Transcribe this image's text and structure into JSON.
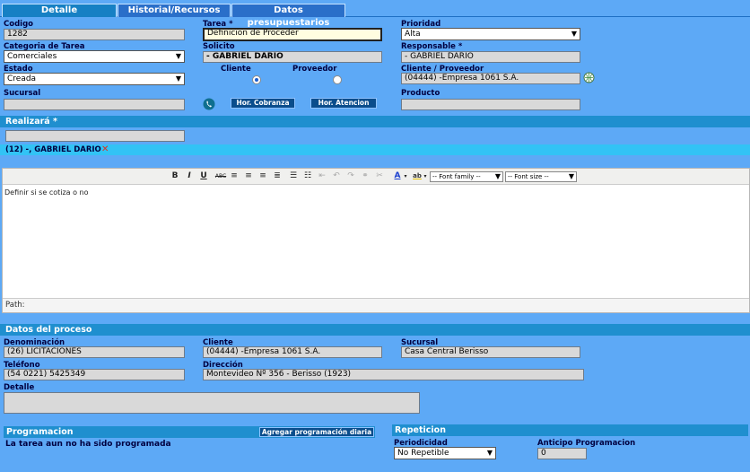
{
  "tabs": [
    {
      "label": "Detalle"
    },
    {
      "label": "Historial/Recursos"
    },
    {
      "label": "Datos presupuestarios"
    }
  ],
  "form": {
    "codigo": {
      "label": "Codigo",
      "value": "1282"
    },
    "tarea": {
      "label": "Tarea *",
      "value": "Definicion de Proceder"
    },
    "prioridad": {
      "label": "Prioridad",
      "value": "Alta"
    },
    "categoria": {
      "label": "Categoria de Tarea",
      "value": "Comerciales"
    },
    "solicito": {
      "label": "Solicito",
      "value": "- GABRIEL DARIO"
    },
    "responsable": {
      "label": "Responsable *",
      "value": "- GABRIEL DARIO"
    },
    "estado": {
      "label": "Estado",
      "value": "Creada"
    },
    "cliente_radio": {
      "label": "Cliente",
      "selected": true
    },
    "proveedor_radio": {
      "label": "Proveedor",
      "selected": false
    },
    "cliente_proveedor": {
      "label": "Cliente / Proveedor",
      "value": "(04444) -Empresa 1061 S.A."
    },
    "sucursal": {
      "label": "Sucursal",
      "value": ""
    },
    "producto": {
      "label": "Producto",
      "value": ""
    },
    "hor_cobranza_label": "Hor. Cobranza",
    "hor_atencion_label": "Hor. Atencion"
  },
  "realizara": {
    "title": "Realizará *",
    "input_value": "",
    "assignee": "(12) -, GABRIEL DARIO"
  },
  "editor": {
    "toolbar": {
      "bold": "B",
      "italic": "I",
      "underline": "U",
      "strike": "ABC",
      "font_family": "-- Font family --",
      "font_size": "-- Font size --"
    },
    "content": "Definir si se cotiza o no",
    "path_label": "Path:"
  },
  "datos_proceso": {
    "title": "Datos del proceso",
    "denominacion": {
      "label": "Denominación",
      "value": "(26) LICITACIONES"
    },
    "cliente": {
      "label": "Cliente",
      "value": "(04444) -Empresa 1061 S.A."
    },
    "sucursal": {
      "label": "Sucursal",
      "value": "Casa Central Berisso"
    },
    "telefono": {
      "label": "Teléfono",
      "value": "(54 0221) 5425349"
    },
    "direccion": {
      "label": "Dirección",
      "value": "Montevideo Nº 356 - Berisso (1923)"
    },
    "detalle": {
      "label": "Detalle",
      "value": ""
    }
  },
  "programacion": {
    "title": "Programacion",
    "add_button": "Agregar programación diaria",
    "status": "La tarea aun no ha sido programada"
  },
  "repeticion": {
    "title": "Repeticion",
    "periodicidad": {
      "label": "Periodicidad",
      "value": "No Repetible"
    },
    "anticipo": {
      "label": "Anticipo Programacion",
      "value": "0"
    }
  }
}
